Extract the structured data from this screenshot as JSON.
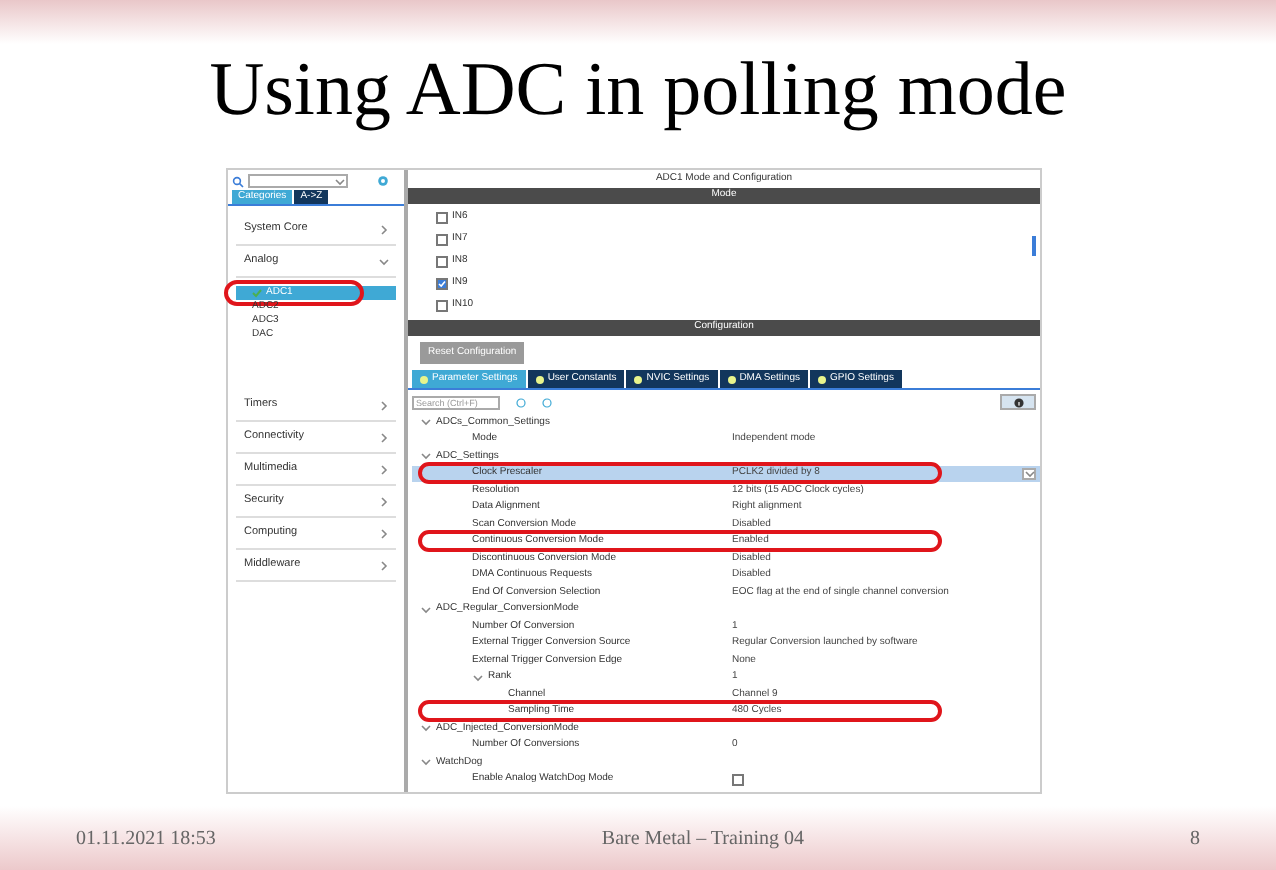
{
  "slide": {
    "title": "Using ADC in polling mode",
    "footer": {
      "date": "01.11.2021 18:53",
      "center": "Bare Metal – Training 04",
      "page": "8"
    }
  },
  "sidebar": {
    "tabs": [
      {
        "label": "Categories",
        "selected": true
      },
      {
        "label": "A->Z",
        "selected": false
      }
    ],
    "categories": [
      {
        "label": "System Core",
        "expanded": false
      },
      {
        "label": "Analog",
        "expanded": true,
        "children": [
          {
            "label": "ADC1",
            "checked": true,
            "selected": true,
            "circled": true
          },
          {
            "label": "ADC2",
            "checked": false,
            "selected": false,
            "circled": false
          },
          {
            "label": "ADC3",
            "checked": false,
            "selected": false,
            "circled": false
          },
          {
            "label": "DAC",
            "checked": false,
            "selected": false,
            "circled": false
          }
        ]
      },
      {
        "label": "Timers",
        "expanded": false
      },
      {
        "label": "Connectivity",
        "expanded": false
      },
      {
        "label": "Multimedia",
        "expanded": false
      },
      {
        "label": "Security",
        "expanded": false
      },
      {
        "label": "Computing",
        "expanded": false
      },
      {
        "label": "Middleware",
        "expanded": false
      }
    ]
  },
  "panel": {
    "title": "ADC1 Mode and Configuration",
    "mode_header": "Mode",
    "channels": [
      {
        "label": "IN6",
        "checked": false
      },
      {
        "label": "IN7",
        "checked": false
      },
      {
        "label": "IN8",
        "checked": false
      },
      {
        "label": "IN9",
        "checked": true
      },
      {
        "label": "IN10",
        "checked": false
      }
    ],
    "config_header": "Configuration",
    "reset_button": "Reset Configuration",
    "tabs": [
      {
        "label": "Parameter Settings",
        "selected": true
      },
      {
        "label": "User Constants",
        "selected": false
      },
      {
        "label": "NVIC Settings",
        "selected": false
      },
      {
        "label": "DMA Settings",
        "selected": false
      },
      {
        "label": "GPIO Settings",
        "selected": false
      }
    ],
    "search": {
      "placeholder": "Search (Ctrl+F)"
    },
    "parameters": [
      {
        "label": "ADCs_Common_Settings",
        "expanded": true,
        "children": [
          {
            "label": "Mode",
            "value": "Independent mode"
          }
        ]
      },
      {
        "label": "ADC_Settings",
        "expanded": true,
        "children": [
          {
            "label": "Clock Prescaler",
            "value": "PCLK2 divided by 8",
            "selected": true,
            "circled": true
          },
          {
            "label": "Resolution",
            "value": "12 bits (15 ADC Clock cycles)"
          },
          {
            "label": "Data Alignment",
            "value": "Right alignment"
          },
          {
            "label": "Scan Conversion Mode",
            "value": "Disabled"
          },
          {
            "label": "Continuous Conversion Mode",
            "value": "Enabled",
            "circled": true
          },
          {
            "label": "Discontinuous Conversion Mode",
            "value": "Disabled"
          },
          {
            "label": "DMA Continuous Requests",
            "value": "Disabled"
          },
          {
            "label": "End Of Conversion Selection",
            "value": "EOC flag at the end of single channel conversion"
          }
        ]
      },
      {
        "label": "ADC_Regular_ConversionMode",
        "expanded": true,
        "children": [
          {
            "label": "Number Of Conversion",
            "value": "1"
          },
          {
            "label": "External Trigger Conversion Source",
            "value": "Regular Conversion launched by software"
          },
          {
            "label": "External Trigger Conversion Edge",
            "value": "None"
          },
          {
            "label": "Rank",
            "value": "1",
            "expanded": true,
            "children": [
              {
                "label": "Channel",
                "value": "Channel 9"
              },
              {
                "label": "Sampling Time",
                "value": "480 Cycles",
                "circled": true
              }
            ]
          }
        ]
      },
      {
        "label": "ADC_Injected_ConversionMode",
        "expanded": true,
        "children": [
          {
            "label": "Number Of Conversions",
            "value": "0"
          }
        ]
      },
      {
        "label": "WatchDog",
        "expanded": true,
        "children": [
          {
            "label": "Enable Analog WatchDog Mode",
            "kind": "checkbox",
            "checked": false
          }
        ]
      }
    ]
  }
}
